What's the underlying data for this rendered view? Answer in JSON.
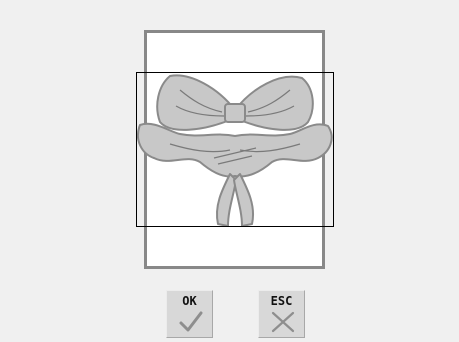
{
  "screen": {
    "background": "#f0f0f0"
  },
  "preview": {
    "image": "bow-ribbon-embroidery",
    "frame_color": "#000000",
    "hoop_color": "#888888"
  },
  "buttons": {
    "ok": {
      "label": "OK",
      "icon": "checkmark-icon"
    },
    "esc": {
      "label": "ESC",
      "icon": "cross-icon"
    }
  }
}
